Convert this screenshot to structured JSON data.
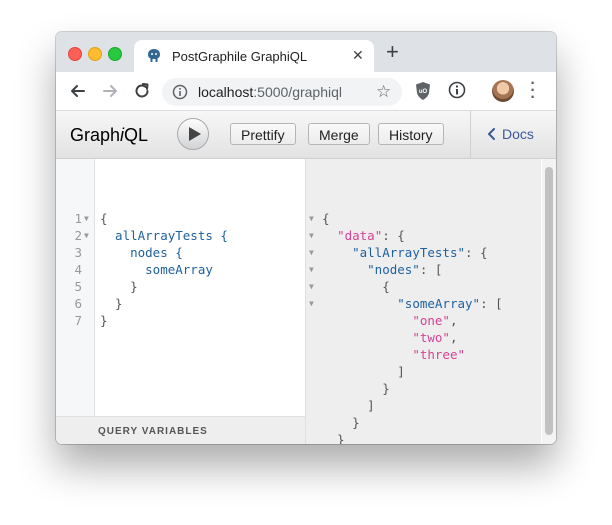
{
  "browser": {
    "tab_title": "PostGraphile GraphiQL",
    "tab_close": "✕",
    "new_tab": "+",
    "url_host": "localhost",
    "url_path": ":5000/graphiql"
  },
  "graphiql": {
    "logo_pre": "Graph",
    "logo_i": "i",
    "logo_post": "QL",
    "buttons": {
      "prettify": "Prettify",
      "merge": "Merge",
      "history": "History"
    },
    "docs_label": "Docs",
    "query_variables_label": "QUERY VARIABLES"
  },
  "query": {
    "lines": [
      {
        "num": "1",
        "text": "{"
      },
      {
        "num": "2",
        "text": "  allArrayTests {"
      },
      {
        "num": "3",
        "text": "    nodes {"
      },
      {
        "num": "4",
        "text": "      someArray"
      },
      {
        "num": "5",
        "text": "    }"
      },
      {
        "num": "6",
        "text": "  }"
      },
      {
        "num": "7",
        "text": "}"
      }
    ]
  },
  "result": {
    "lines": [
      "{",
      "  \"data\": {",
      "    \"allArrayTests\": {",
      "      \"nodes\": [",
      "        {",
      "          \"someArray\": [",
      "            \"one\",",
      "            \"two\",",
      "            \"three\"",
      "          ]",
      "        }",
      "      ]",
      "    }",
      "  }",
      "}"
    ],
    "keys": {
      "data": "\"data\"",
      "allArrayTests": "\"allArrayTests\"",
      "nodes": "\"nodes\"",
      "someArray": "\"someArray\""
    },
    "values": [
      "\"one\"",
      "\"two\"",
      "\"three\""
    ]
  },
  "colors": {
    "docs_link": "#3B5998",
    "field": "#1F61A0",
    "string": "#D64292"
  }
}
